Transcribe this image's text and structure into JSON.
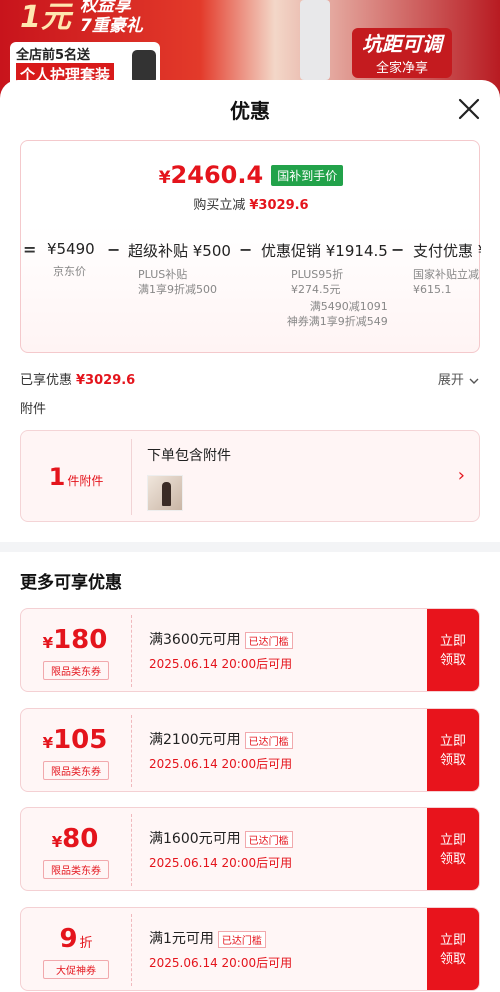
{
  "banner": {
    "big_number": "1元",
    "rights_line1": "权益享",
    "rights_line2": "7重豪礼",
    "store_line1": "全店前5名送",
    "store_line2": "个人护理套装",
    "right_title": "坑距可调",
    "right_subtitle": "全家净享"
  },
  "sheet": {
    "title": "优惠",
    "close_icon": "close-icon"
  },
  "price_summary": {
    "final_price_symbol": "¥",
    "final_price": "2460.4",
    "final_tag": "国补到手价",
    "reduce_label": "购买立减",
    "reduce_amount": "¥3029.6"
  },
  "formula": {
    "items": [
      {
        "op": "=",
        "main": "¥5490",
        "sub1": "京东价",
        "sub2": "",
        "sub3": ""
      },
      {
        "op": "−",
        "main": "超级补贴 ¥500",
        "sub1": "PLUS补贴",
        "sub2": "满1享9折减500",
        "sub3": ""
      },
      {
        "op": "−",
        "main": "优惠促销 ¥1914.5",
        "sub1": "PLUS95折",
        "sub2": "¥274.5元",
        "sub3": "满5490减1091",
        "sub4": "神券满1享9折减549"
      },
      {
        "op": "−",
        "main": "支付优惠 ¥",
        "sub1": "国家补贴立减",
        "sub2": "¥615.1",
        "sub3": ""
      }
    ]
  },
  "enjoyed": {
    "label": "已享优惠",
    "amount": "¥3029.6",
    "expand_label": "展开"
  },
  "attachment": {
    "section_label": "附件",
    "count": "1",
    "count_unit": "件附件",
    "title": "下单包含附件"
  },
  "more": {
    "title": "更多可享优惠"
  },
  "coupons": [
    {
      "symbol": "¥",
      "amount": "180",
      "suffix": "",
      "type": "限品类东券",
      "condition": "满3600元可用",
      "badge": "已达门槛",
      "time": "2025.06.14  20:00后可用",
      "claim": "立即领取"
    },
    {
      "symbol": "¥",
      "amount": "105",
      "suffix": "",
      "type": "限品类东券",
      "condition": "满2100元可用",
      "badge": "已达门槛",
      "time": "2025.06.14  20:00后可用",
      "claim": "立即领取"
    },
    {
      "symbol": "¥",
      "amount": "80",
      "suffix": "",
      "type": "限品类东券",
      "condition": "满1600元可用",
      "badge": "已达门槛",
      "time": "2025.06.14  20:00后可用",
      "claim": "立即领取"
    },
    {
      "symbol": "",
      "amount": "9",
      "suffix": "折",
      "type": "大促神券",
      "condition": "满1元可用",
      "badge": "已达门槛",
      "time": "2025.06.14  20:00后可用",
      "claim": "立即领取"
    }
  ],
  "colors": {
    "accent_red": "#e4141c",
    "tag_green": "#22a24a",
    "coupon_bg": "#fff6f6"
  }
}
